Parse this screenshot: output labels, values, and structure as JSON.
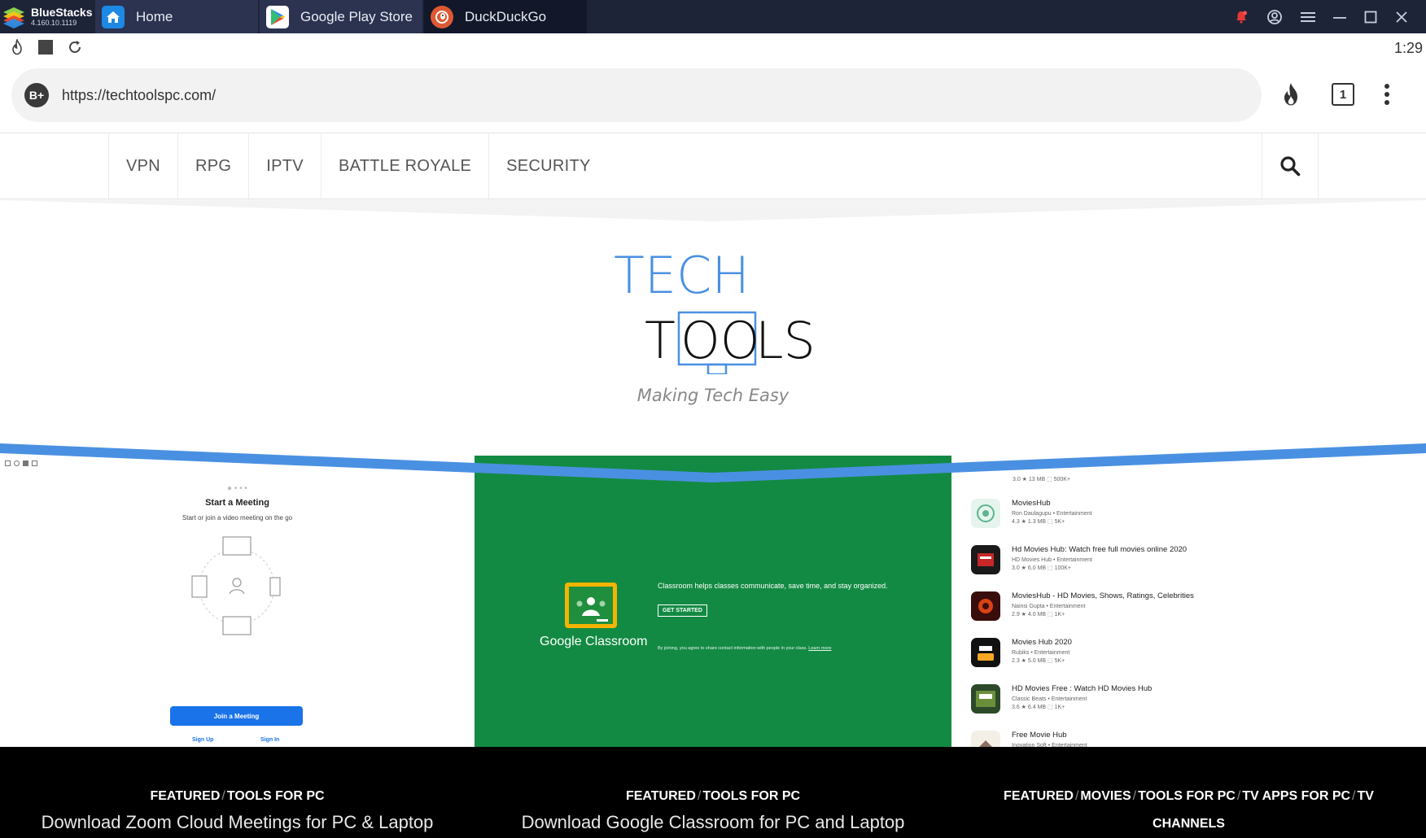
{
  "titlebar": {
    "brand_name": "BlueStacks",
    "brand_version": "4.160.10.1119",
    "tabs": [
      {
        "label": "Home",
        "icon": "home-icon"
      },
      {
        "label": "Google Play Store",
        "icon": "play-store-icon"
      },
      {
        "label": "DuckDuckGo",
        "icon": "duckduckgo-icon"
      }
    ]
  },
  "status": {
    "clock": "1:29"
  },
  "browser": {
    "url": "https://techtoolspc.com/",
    "badge": "B+",
    "tab_count": "1"
  },
  "site": {
    "nav": [
      "VPN",
      "RPG",
      "IPTV",
      "BATTLE ROYALE",
      "SECURITY"
    ],
    "logo_top": "TECH",
    "logo_bottom_1": "T",
    "logo_bottom_2": "OO",
    "logo_bottom_3": "LS",
    "tagline": "Making Tech Easy"
  },
  "cards": [
    {
      "categories": [
        "FEATURED",
        "TOOLS FOR PC"
      ],
      "title": "Download Zoom Cloud Meetings for PC & Laptop",
      "screen": {
        "heading": "Start a Meeting",
        "sub": "Start or join a video meeting on the go",
        "join": "Join a Meeting",
        "signup": "Sign Up",
        "signin": "Sign In"
      }
    },
    {
      "categories": [
        "FEATURED",
        "TOOLS FOR PC"
      ],
      "title": "Download Google Classroom for PC and Laptop",
      "screen": {
        "brand": "Google Classroom",
        "desc": "Classroom helps classes communicate, save time, and stay organized.",
        "cta": "GET STARTED",
        "legal": "By joining, you agree to share contact information with people in your class.",
        "learn": "Learn more"
      }
    },
    {
      "categories": [
        "FEATURED",
        "MOVIES",
        "TOOLS FOR PC",
        "TV APPS FOR PC",
        "TV"
      ],
      "categories_line2": "CHANNELS",
      "screen": {
        "top_meta": "3.0 ★   13 MB   ⬚ 500K+",
        "apps": [
          {
            "name": "MoviesHub",
            "sub": "Ron Daulagupu  •  Entertainment",
            "meta": "4.3 ★   1.3 MB   ⬚ 5K+",
            "color": "#e6f4ee"
          },
          {
            "name": "Hd Movies Hub: Watch free full movies online 2020",
            "sub": "HD Movies Hub  •  Entertainment",
            "meta": "3.0 ★   6.0 MB   ⬚ 100K+",
            "color": "#1a1a1a"
          },
          {
            "name": "MoviesHub - HD Movies, Shows, Ratings, Celebrities",
            "sub": "Nainsi Gupta  •  Entertainment",
            "meta": "2.9 ★   4.0 MB   ⬚ 1K+",
            "color": "#3a0d0d"
          },
          {
            "name": "Movies Hub 2020",
            "sub": "Rubiks  •  Entertainment",
            "meta": "2.3 ★   5.0 MB   ⬚ 5K+",
            "color": "#111111"
          },
          {
            "name": "HD Movies Free : Watch HD Movies Hub",
            "sub": "Classic Beats  •  Entertainment",
            "meta": "3.6 ★   6.4 MB   ⬚ 1K+",
            "color": "#2c4a2a"
          },
          {
            "name": "Free Movie Hub",
            "sub": "Inovation Soft  •  Entertainment",
            "meta": "",
            "color": "#f3efe6"
          }
        ]
      }
    }
  ],
  "colors": {
    "titlebar": "#1d2438",
    "accent_blue": "#4a90e2",
    "classroom_green": "#138a43",
    "zoom_blue": "#1a73e8"
  }
}
